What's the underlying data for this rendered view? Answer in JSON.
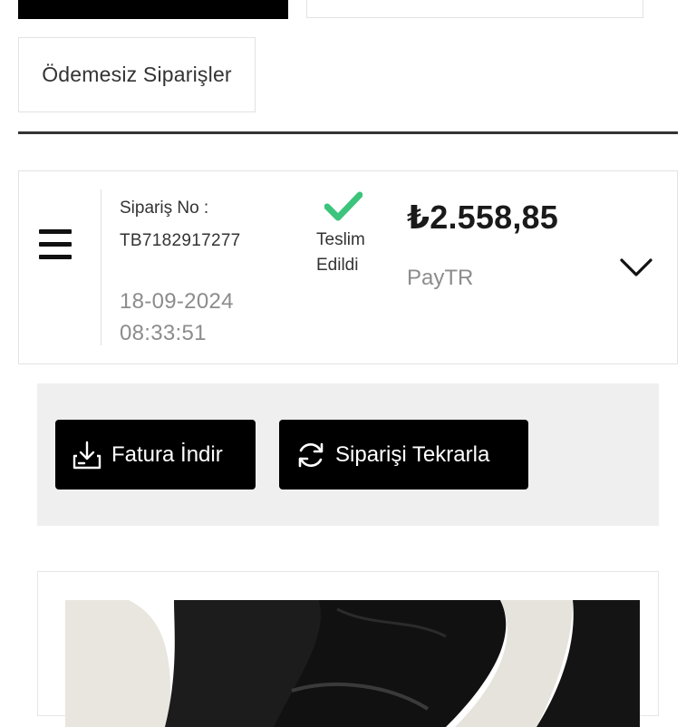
{
  "tabs": {
    "filter_unpaid": "Ödemesiz Siparişler"
  },
  "order": {
    "order_no_label": "Sipariş No :",
    "order_no": "TB7182917277",
    "date": "18-09-2024",
    "time": "08:33:51",
    "status_line1": "Teslim",
    "status_line2": "Edildi",
    "price": "₺2.558,85",
    "payment_method": "PayTR"
  },
  "actions": {
    "invoice_label": "Fatura İndir",
    "reorder_label": "Siparişi Tekrarla"
  },
  "icons": {
    "menu": "hamburger-icon",
    "status": "check-icon",
    "expand": "chevron-down-icon",
    "invoice": "download-icon",
    "reorder": "refresh-icon"
  },
  "colors": {
    "status_green": "#3cc47c",
    "button_bg": "#000000",
    "panel_bg": "#efefef",
    "muted_text": "#8c8c8c"
  }
}
